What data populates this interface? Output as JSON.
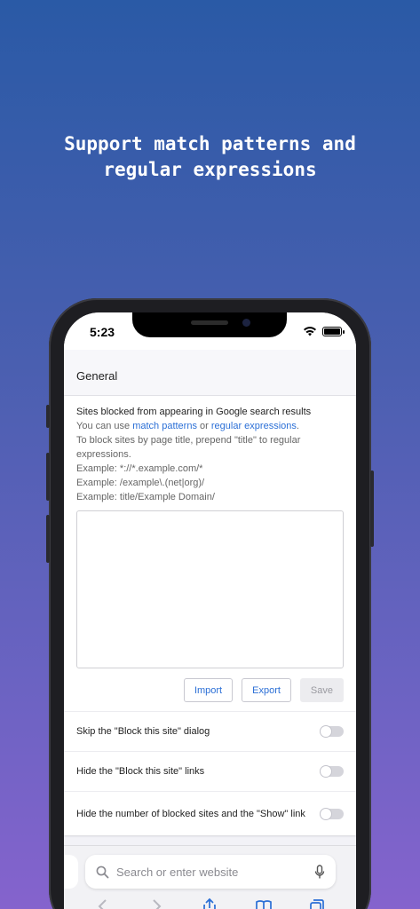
{
  "headline": [
    "Support match patterns and",
    "regular expressions"
  ],
  "status_bar": {
    "time": "5:23"
  },
  "section": {
    "title": "General"
  },
  "description": {
    "title": "Sites blocked from appearing in Google search results",
    "usage_prefix": "You can use ",
    "match_patterns_link": "match patterns",
    "usage_middle": " or ",
    "regex_link": "regular expressions",
    "usage_suffix": ".",
    "title_hint": "To block sites by page title, prepend \"title\" to regular expressions.",
    "example1": "Example: *://*.example.com/*",
    "example2": "Example: /example\\.(net|org)/",
    "example3": "Example: title/Example Domain/"
  },
  "textarea": {
    "value": ""
  },
  "buttons": {
    "import": "Import",
    "export": "Export",
    "save": "Save"
  },
  "toggles": [
    {
      "label": "Skip the \"Block this site\" dialog",
      "on": false
    },
    {
      "label": "Hide the \"Block this site\" links",
      "on": false
    },
    {
      "label": "Hide the number of blocked sites and the \"Show\" link",
      "on": false
    }
  ],
  "safari": {
    "search_placeholder": "Search or enter website"
  },
  "colors": {
    "link": "#2b6fd6",
    "gradient_top": "#2a5aa6",
    "gradient_bottom": "#8563cd"
  }
}
